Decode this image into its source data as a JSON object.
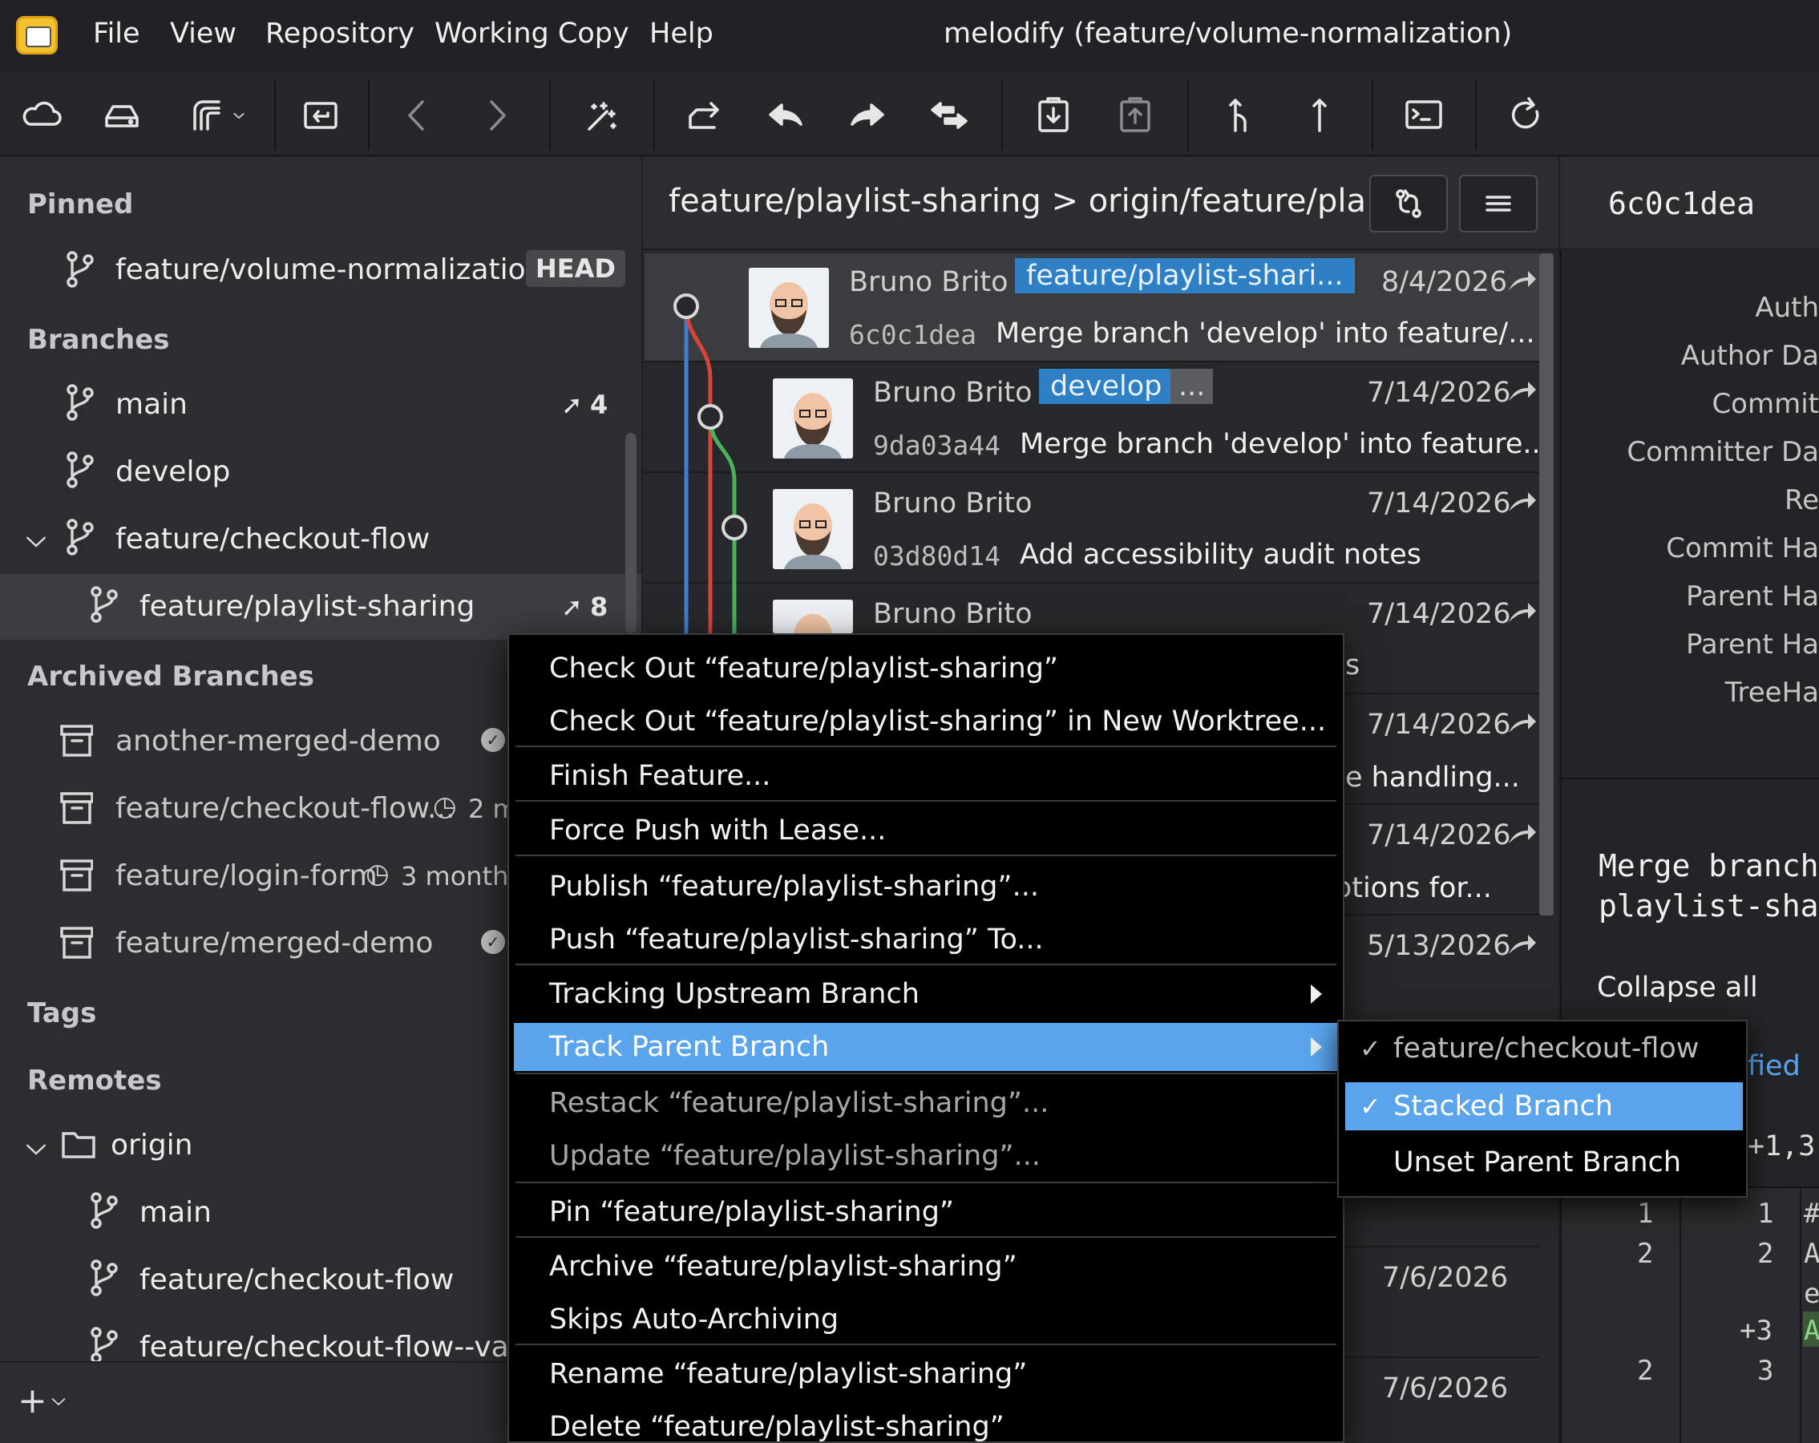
{
  "menubar": {
    "items": [
      "File",
      "View",
      "Repository",
      "Working Copy",
      "Help"
    ],
    "title": "melodify (feature/volume-normalization)"
  },
  "toolbar": {
    "buttons": [
      "cloud-icon",
      "drive-icon",
      "fork-icon",
      "dropdown-icon",
      "checkout-icon",
      "back-icon",
      "forward-icon",
      "magic-wand-icon",
      "share-icon",
      "undo-icon",
      "redo-icon",
      "sync-icon",
      "stash-icon",
      "unstash-icon",
      "pull-icon",
      "push-icon",
      "terminal-icon",
      "refresh-icon"
    ]
  },
  "sidebar": {
    "pinned_title": "Pinned",
    "pinned": {
      "label": "feature/volume-normalization",
      "badge": "HEAD"
    },
    "branches_title": "Branches",
    "branches": [
      {
        "label": "main",
        "count": "4"
      },
      {
        "label": "develop",
        "count": ""
      },
      {
        "label": "feature/checkout-flow",
        "count": ""
      },
      {
        "label": "feature/playlist-sharing",
        "count": "8"
      }
    ],
    "archived_title": "Archived Branches",
    "archived": [
      {
        "label": "another-merged-demo",
        "meta": ""
      },
      {
        "label": "feature/checkout-flow...",
        "meta": "2 m"
      },
      {
        "label": "feature/login-form",
        "meta": "3 months"
      },
      {
        "label": "feature/merged-demo",
        "meta": ""
      }
    ],
    "tags_title": "Tags",
    "remotes_title": "Remotes",
    "remote": "origin",
    "remote_branches": [
      "main",
      "feature/checkout-flow",
      "feature/checkout-flow--valid"
    ],
    "add_label": "+"
  },
  "center": {
    "branch_path": "feature/playlist-sharing  >  origin/feature/pla...",
    "commits": [
      {
        "author": "Bruno Brito",
        "tag": "feature/playlist-shari...",
        "extra": "",
        "date": "8/4/2026",
        "hash": "6c0c1dea",
        "message": "Merge branch 'develop' into feature/..."
      },
      {
        "author": "Bruno Brito",
        "tag": "develop",
        "extra": "...",
        "date": "7/14/2026",
        "hash": "9da03a44",
        "message": "Merge branch 'develop' into feature..."
      },
      {
        "author": "Bruno Brito",
        "tag": "",
        "extra": "",
        "date": "7/14/2026",
        "hash": "03d80d14",
        "message": "Add accessibility audit notes"
      },
      {
        "author": "Bruno Brito",
        "tag": "",
        "extra": "",
        "date": "7/14/2026",
        "hash": "",
        "message": "s"
      },
      {
        "author": "",
        "tag": "",
        "extra": "",
        "date": "7/14/2026",
        "hash": "",
        "message": "e handling..."
      },
      {
        "author": "",
        "tag": "",
        "extra": "",
        "date": "7/14/2026",
        "hash": "",
        "message": "ptions for..."
      },
      {
        "author": "",
        "tag": "",
        "extra": "",
        "date": "5/13/2026",
        "hash": "",
        "message": ""
      },
      {
        "author": "",
        "tag": "",
        "extra": "",
        "date": "7/6/2026",
        "hash": "",
        "message": ""
      },
      {
        "author": "",
        "tag": "",
        "extra": "",
        "date": "7/6/2026",
        "hash": "",
        "message": ""
      }
    ]
  },
  "details": {
    "commit_id": "6c0c1dea",
    "labels": [
      "Auth",
      "Author Da",
      "Commit",
      "Committer Da",
      "Re",
      "Commit Ha",
      "Parent Ha",
      "Parent Ha",
      "TreeHa"
    ],
    "message": "Merge branch\nplaylist-sha",
    "collapse": "Collapse all",
    "modified": "fied",
    "hunk": "+1,3",
    "diff_rows": [
      {
        "a": "1",
        "b": "1",
        "c": "#"
      },
      {
        "a": "2",
        "b": "2",
        "c": "A"
      },
      {
        "a": "",
        "b": "",
        "c": "e"
      },
      {
        "a": "",
        "b": "+3",
        "c": "A"
      },
      {
        "a": "2",
        "b": "3",
        "c": ""
      }
    ]
  },
  "context_menu": {
    "items": [
      "Check Out “feature/playlist-sharing”",
      "Check Out  “feature/playlist-sharing” in New Worktree...",
      "Finish Feature...",
      "Force Push with Lease...",
      "Publish “feature/playlist-sharing”...",
      "Push “feature/playlist-sharing” To...",
      "Tracking Upstream Branch",
      "Track Parent Branch",
      "Restack “feature/playlist-sharing”...",
      "Update “feature/playlist-sharing”...",
      "Pin “feature/playlist-sharing”",
      "Archive “feature/playlist-sharing”",
      "Skips Auto-Archiving",
      "Rename “feature/playlist-sharing”",
      "Delete “feature/playlist-sharing”"
    ]
  },
  "submenu": {
    "items": [
      "feature/checkout-flow",
      "Stacked Branch",
      "Unset Parent Branch"
    ],
    "checkmark": "✓"
  },
  "colors": {
    "accent": "#5aa4ec",
    "tag": "#2f7fc4",
    "graph_blue": "#3e7fcf",
    "graph_red": "#d9453a",
    "graph_green": "#49b25c"
  }
}
